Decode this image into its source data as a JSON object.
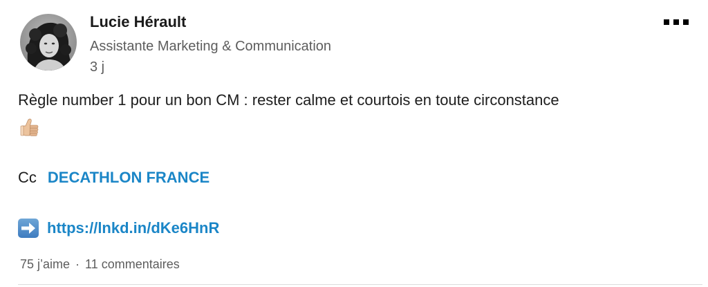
{
  "author": {
    "name": "Lucie Hérault",
    "headline": "Assistante Marketing & Communication",
    "time": "3 j"
  },
  "post": {
    "text": "Règle number 1 pour un bon CM : rester calme et courtois en toute circonstance",
    "emoji_icon": "thumbs-up-icon",
    "cc_label": "Cc",
    "mention": "DECATHLON FRANCE",
    "arrow_icon": "right-arrow-icon",
    "url": "https://lnkd.in/dKe6HnR"
  },
  "social": {
    "likes": "75 j’aime",
    "separator": "·",
    "comments": "11 commentaires"
  },
  "colors": {
    "link": "#1b86c7",
    "secondary_text": "#5d5d5d",
    "primary_text": "#1d1d1d"
  }
}
